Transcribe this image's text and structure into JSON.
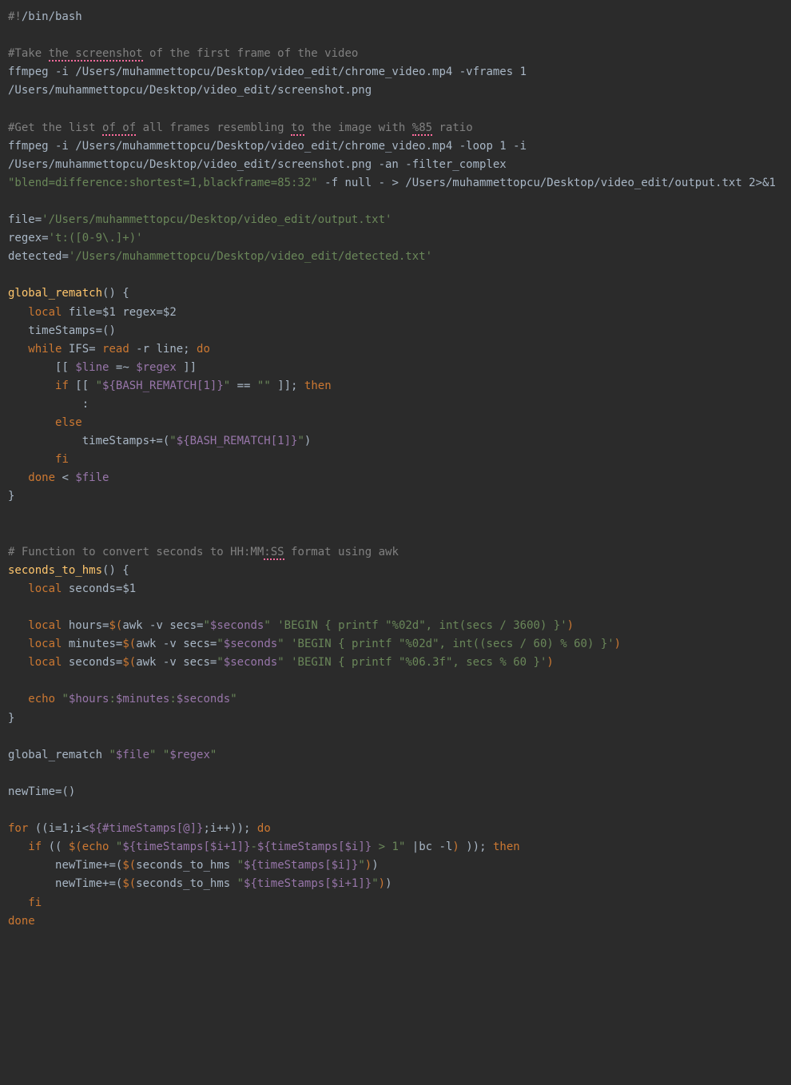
{
  "lines": {
    "l1_shebang": "#!",
    "l1_binbash": "/bin/bash",
    "l3_comment_pre": "#Take ",
    "l3_comment_u1": "the screenshot",
    "l3_comment_post": " of the first frame of the video",
    "l4_cmd": "ffmpeg -i /Users/muhammettopcu/Desktop/video_edit/chrome_video.mp4 -vframes 1 /Users/muhammettopcu/Desktop/video_edit/screenshot.png",
    "l7_comment_pre": "#Get the list ",
    "l7_comment_u1": "of of",
    "l7_comment_mid1": " all frames resembling ",
    "l7_comment_u2": "to",
    "l7_comment_mid2": " the image with ",
    "l7_comment_u3": "%85",
    "l7_comment_post": " ratio",
    "l8_cmd_a": "ffmpeg -i /Users/muhammettopcu/Desktop/video_edit/chrome_video.mp4 -loop 1 -i /Users/muhammettopcu/Desktop/video_edit/screenshot.png -an -filter_complex ",
    "l8_str": "\"blend=difference:shortest=1,blackframe=85:32\"",
    "l8_cmd_b": " -f null - > /Users/muhammettopcu/Desktop/video_edit/output.txt 2>&1",
    "l12_var": "file",
    "l12_eq": "=",
    "l12_str": "'/Users/muhammettopcu/Desktop/video_edit/output.txt'",
    "l13_var": "regex",
    "l13_eq": "=",
    "l13_str": "'t:([0-9\\.]+)'",
    "l14_var": "detected",
    "l14_eq": "=",
    "l14_str": "'/Users/muhammettopcu/Desktop/video_edit/detected.txt'",
    "l16_fn": "global_rematch",
    "l16_paren": "() {",
    "l17_local": "   local ",
    "l17_v1": "file",
    "l17_eq1": "=",
    "l17_a1": "$1",
    "l17_sp": " ",
    "l17_v2": "regex",
    "l17_eq2": "=",
    "l17_a2": "$2",
    "l18": "   timeStamps=()",
    "l19_pre": "   ",
    "l19_while": "while ",
    "l19_ifs": "IFS",
    "l19_eq": "= ",
    "l19_read": "read",
    "l19_post": " -r line; ",
    "l19_do": "do",
    "l20_pre": "       [[ ",
    "l20_v1": "$line",
    "l20_mid": " =~ ",
    "l20_v2": "$regex",
    "l20_post": " ]]",
    "l21_pre": "       ",
    "l21_if": "if",
    "l21_mid1": " [[ ",
    "l21_str1": "\"",
    "l21_var": "${BASH_REMATCH[1]}",
    "l21_str2": "\"",
    "l21_mid2": " == ",
    "l21_str3": "\"\"",
    "l21_post": " ]]; ",
    "l21_then": "then",
    "l22": "           :",
    "l23_pre": "       ",
    "l23_else": "else",
    "l24_pre": "           timeStamps+=(",
    "l24_str1": "\"",
    "l24_var": "${BASH_REMATCH[1]}",
    "l24_str2": "\"",
    "l24_post": ")",
    "l25_pre": "       ",
    "l25_fi": "fi",
    "l26_pre": "   ",
    "l26_done": "done",
    "l26_mid": " < ",
    "l26_var": "$file",
    "l27": "}",
    "l30_pre": "# Function to convert seconds to HH:MM",
    "l30_u": ":SS",
    "l30_post": " format using awk",
    "l31_fn": "seconds_to_hms",
    "l31_paren": "() {",
    "l32_local": "   local ",
    "l32_v": "seconds",
    "l32_eq": "=",
    "l32_a": "$1",
    "l34_local": "   local ",
    "l34_v": "hours",
    "l34_eq": "=",
    "l34_d1": "$(",
    "l34_cmd": "awk -v secs=",
    "l34_str1": "\"",
    "l34_var": "$seconds",
    "l34_str2": "\"",
    "l34_sp": " ",
    "l34_str3": "'BEGIN { printf \"%02d\", int(secs / 3600) }'",
    "l34_d2": ")",
    "l35_local": "   local ",
    "l35_v": "minutes",
    "l35_eq": "=",
    "l35_d1": "$(",
    "l35_cmd": "awk -v secs=",
    "l35_str1": "\"",
    "l35_var": "$seconds",
    "l35_str2": "\"",
    "l35_sp": " ",
    "l35_str3": "'BEGIN { printf \"%02d\", int((secs / 60) % 60) }'",
    "l35_d2": ")",
    "l36_local": "   local ",
    "l36_v": "seconds",
    "l36_eq": "=",
    "l36_d1": "$(",
    "l36_cmd": "awk -v secs=",
    "l36_str1": "\"",
    "l36_var": "$seconds",
    "l36_str2": "\"",
    "l36_sp": " ",
    "l36_str3": "'BEGIN { printf \"%06.3f\", secs % 60 }'",
    "l36_d2": ")",
    "l38_pre": "   ",
    "l38_echo": "echo ",
    "l38_q1": "\"",
    "l38_v1": "$hours",
    "l38_c1": ":",
    "l38_v2": "$minutes",
    "l38_c2": ":",
    "l38_v3": "$seconds",
    "l38_q2": "\"",
    "l39": "}",
    "l41_fn": "global_rematch ",
    "l41_q1": "\"",
    "l41_v1": "$file",
    "l41_q2": "\"",
    "l41_sp": " ",
    "l41_q3": "\"",
    "l41_v2": "$regex",
    "l41_q4": "\"",
    "l43": "newTime=()",
    "l45_for": "for ",
    "l45_p1": "((i=1;i<",
    "l45_var": "${#timeStamps[@]}",
    "l45_p2": ";i++)); ",
    "l45_do": "do",
    "l46_pre": "   ",
    "l46_if": "if",
    "l46_p1": " (( ",
    "l46_d1": "$(",
    "l46_echo": "echo ",
    "l46_q1": "\"",
    "l46_v1": "${timeStamps[$i+1]}",
    "l46_dash": "-",
    "l46_v2": "${timeStamps[$i]}",
    "l46_gt": " > 1",
    "l46_q2": "\"",
    "l46_pipe": " |bc -l",
    "l46_d2": ")",
    "l46_p2": " )); ",
    "l46_then": "then",
    "l47_pre": "       newTime+=(",
    "l47_d1": "$(",
    "l47_fn": "seconds_to_hms ",
    "l47_q1": "\"",
    "l47_v": "${timeStamps[$i]}",
    "l47_q2": "\"",
    "l47_d2": ")",
    "l47_post": ")",
    "l48_pre": "       newTime+=(",
    "l48_d1": "$(",
    "l48_fn": "seconds_to_hms ",
    "l48_q1": "\"",
    "l48_v": "${timeStamps[$i+1]}",
    "l48_q2": "\"",
    "l48_d2": ")",
    "l48_post": ")",
    "l49_pre": "   ",
    "l49_fi": "fi",
    "l50_done": "done"
  }
}
